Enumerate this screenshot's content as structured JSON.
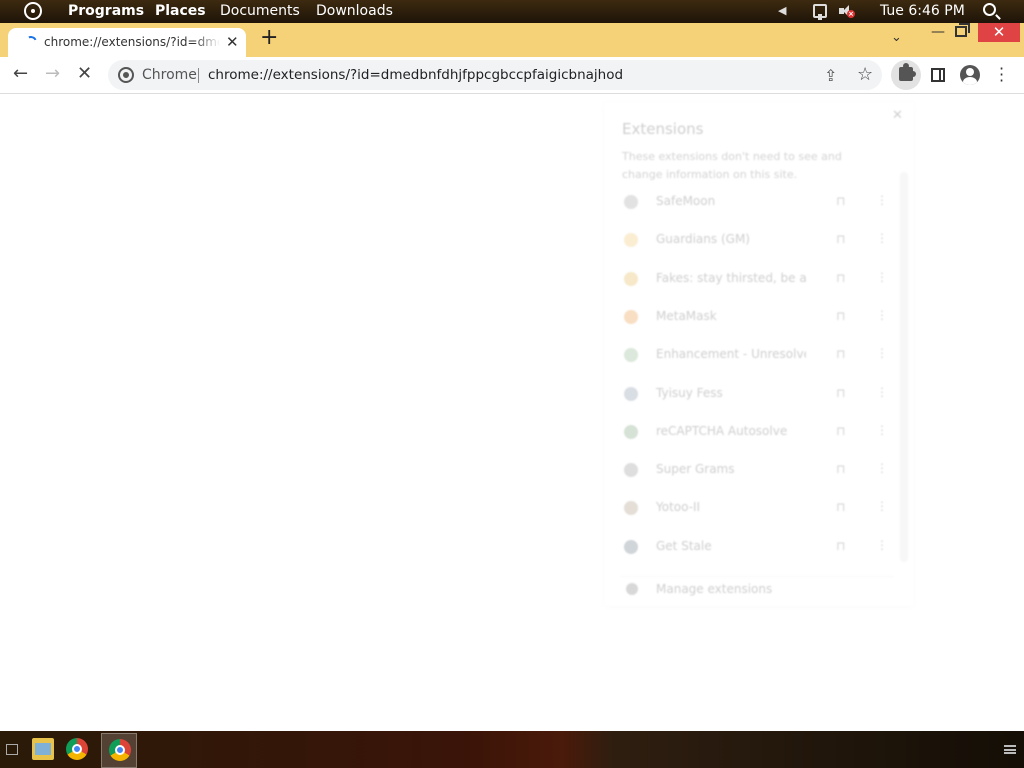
{
  "top_panel": {
    "menus": [
      "Programs",
      "Places",
      "Documents",
      "Downloads"
    ],
    "clock": "Tue 6:46 PM"
  },
  "browser": {
    "tab_title": "chrome://extensions/?id=dmedbnfdhjfppcgbccpfaigicbnajhod",
    "omnibox_chip": "Chrome",
    "url": "chrome://extensions/?id=dmedbnfdhjfppcgbccpfaigicbnajhod"
  },
  "extensions_popup": {
    "title": "Extensions",
    "description": "These extensions don't need to see and change information on this site.",
    "items": [
      {
        "name": "SafeMoon",
        "icon_color": "#9a9a9a"
      },
      {
        "name": "Guardians (GM)",
        "icon_color": "#f0c060"
      },
      {
        "name": "Fakes: stay thirsted, be aware",
        "icon_color": "#e2b040"
      },
      {
        "name": "MetaMask",
        "icon_color": "#e88a2a"
      },
      {
        "name": "Enhancement - Unresolver Mask",
        "icon_color": "#7fb07f"
      },
      {
        "name": "Tyisuy Fess",
        "icon_color": "#7a8aa0"
      },
      {
        "name": "reCAPTCHA Autosolve",
        "icon_color": "#6a9a6a"
      },
      {
        "name": "Super Grams",
        "icon_color": "#8a8a8a"
      },
      {
        "name": "Yotoo-II",
        "icon_color": "#a08a70"
      },
      {
        "name": "Get Stale",
        "icon_color": "#5a6a7a"
      }
    ],
    "manage_label": "Manage extensions"
  }
}
